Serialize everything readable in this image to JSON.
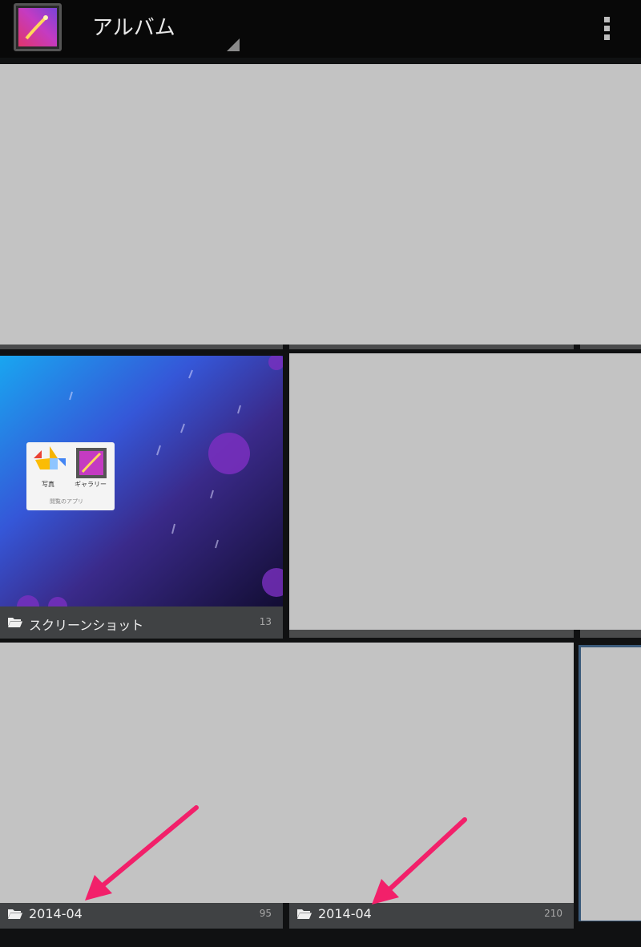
{
  "action_bar": {
    "title": "アルバム",
    "app_icon": "gallery-app-icon",
    "overflow_icon": "overflow-menu-icon"
  },
  "albums": [
    {
      "name": "スクリーンショット",
      "count": "13"
    },
    {
      "name": "2014-04",
      "count": "95"
    },
    {
      "name": "2014-04",
      "count": "210"
    }
  ],
  "thumbnail": {
    "photos_label": "写真",
    "gallery_label": "ギャラリー",
    "footer_label": "閲覧のアプリ"
  },
  "colors": {
    "annotation_arrow": "#f2206a",
    "placeholder": "#c3c3c3",
    "background": "#101112"
  }
}
